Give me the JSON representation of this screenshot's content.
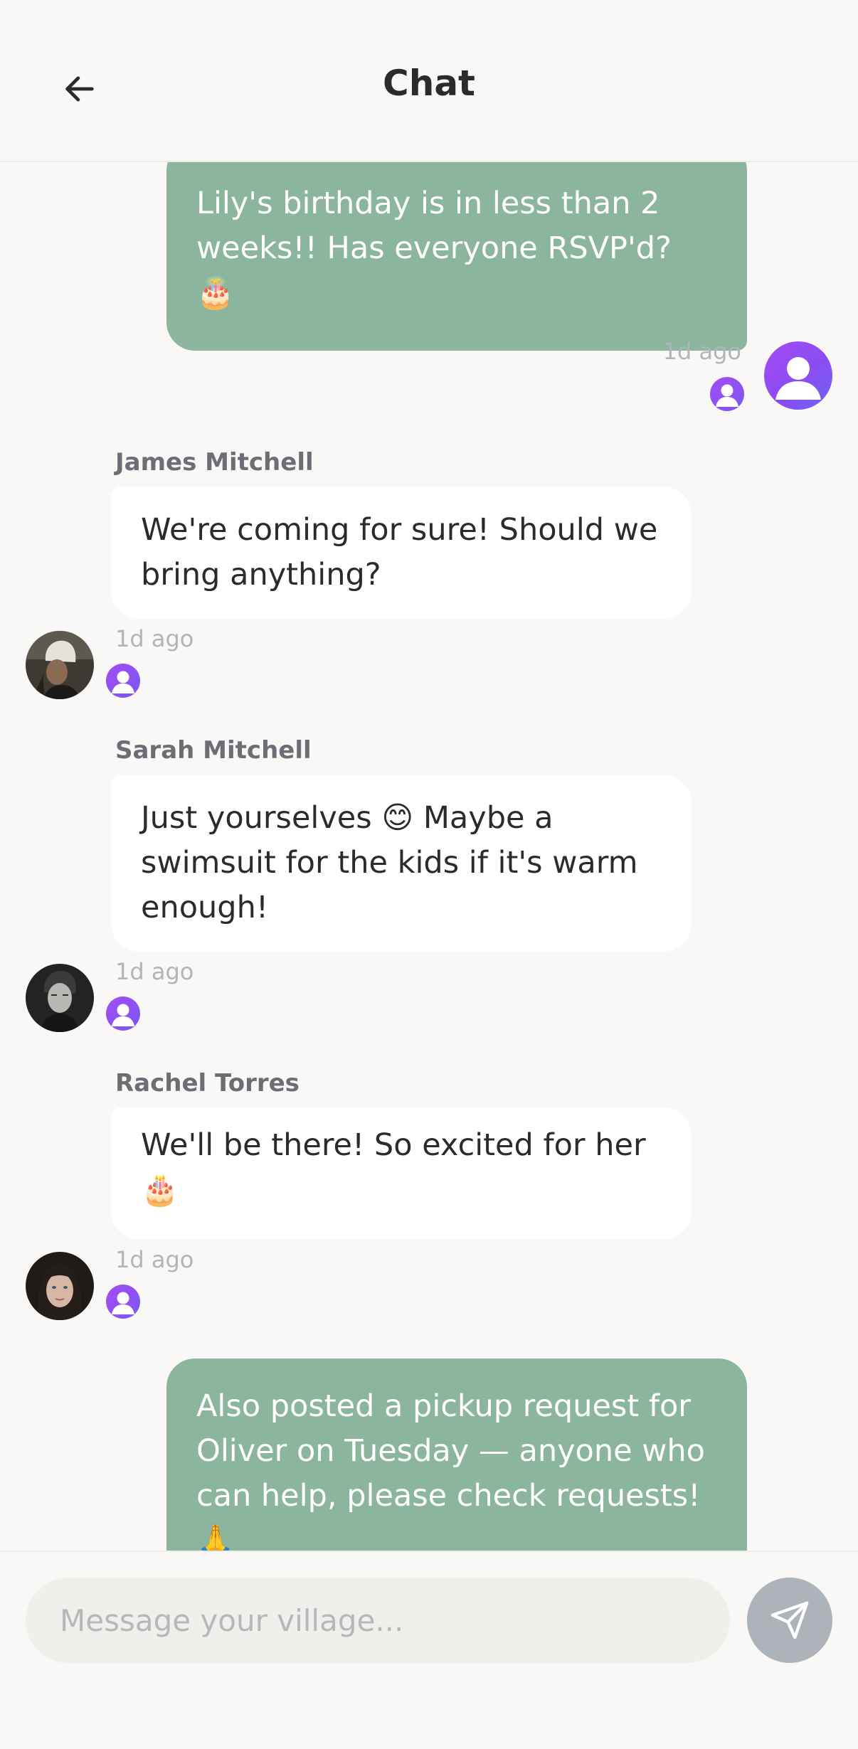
{
  "header": {
    "title": "Chat",
    "back_icon": "arrow-left-icon"
  },
  "messages": [
    {
      "from_me": true,
      "text": "Lily's birthday is in less than 2 weeks!! Has everyone RSVP'd? 🎂",
      "time": "1d ago"
    },
    {
      "from_me": false,
      "sender": "James Mitchell",
      "text": "We're coming for sure! Should we bring anything?",
      "time": "1d ago"
    },
    {
      "from_me": false,
      "sender": "Sarah Mitchell",
      "text": "Just yourselves 😊 Maybe a swimsuit for the kids if it's warm enough!",
      "time": "1d ago"
    },
    {
      "from_me": false,
      "sender": "Rachel Torres",
      "text": "We'll be there! So excited for her 🎂",
      "time": "1d ago"
    },
    {
      "from_me": true,
      "text": "Also posted a pickup request for Oliver on Tuesday — anyone who can help, please check requests! 🙏",
      "time": ""
    }
  ],
  "composer": {
    "placeholder": "Message your village...",
    "send_icon": "send-icon"
  },
  "colors": {
    "my_bubble": "#8bb59c",
    "their_bubble": "#ffffff",
    "avatar_gradient": "#8a4cf1",
    "send_button": "#aeb3b9"
  }
}
